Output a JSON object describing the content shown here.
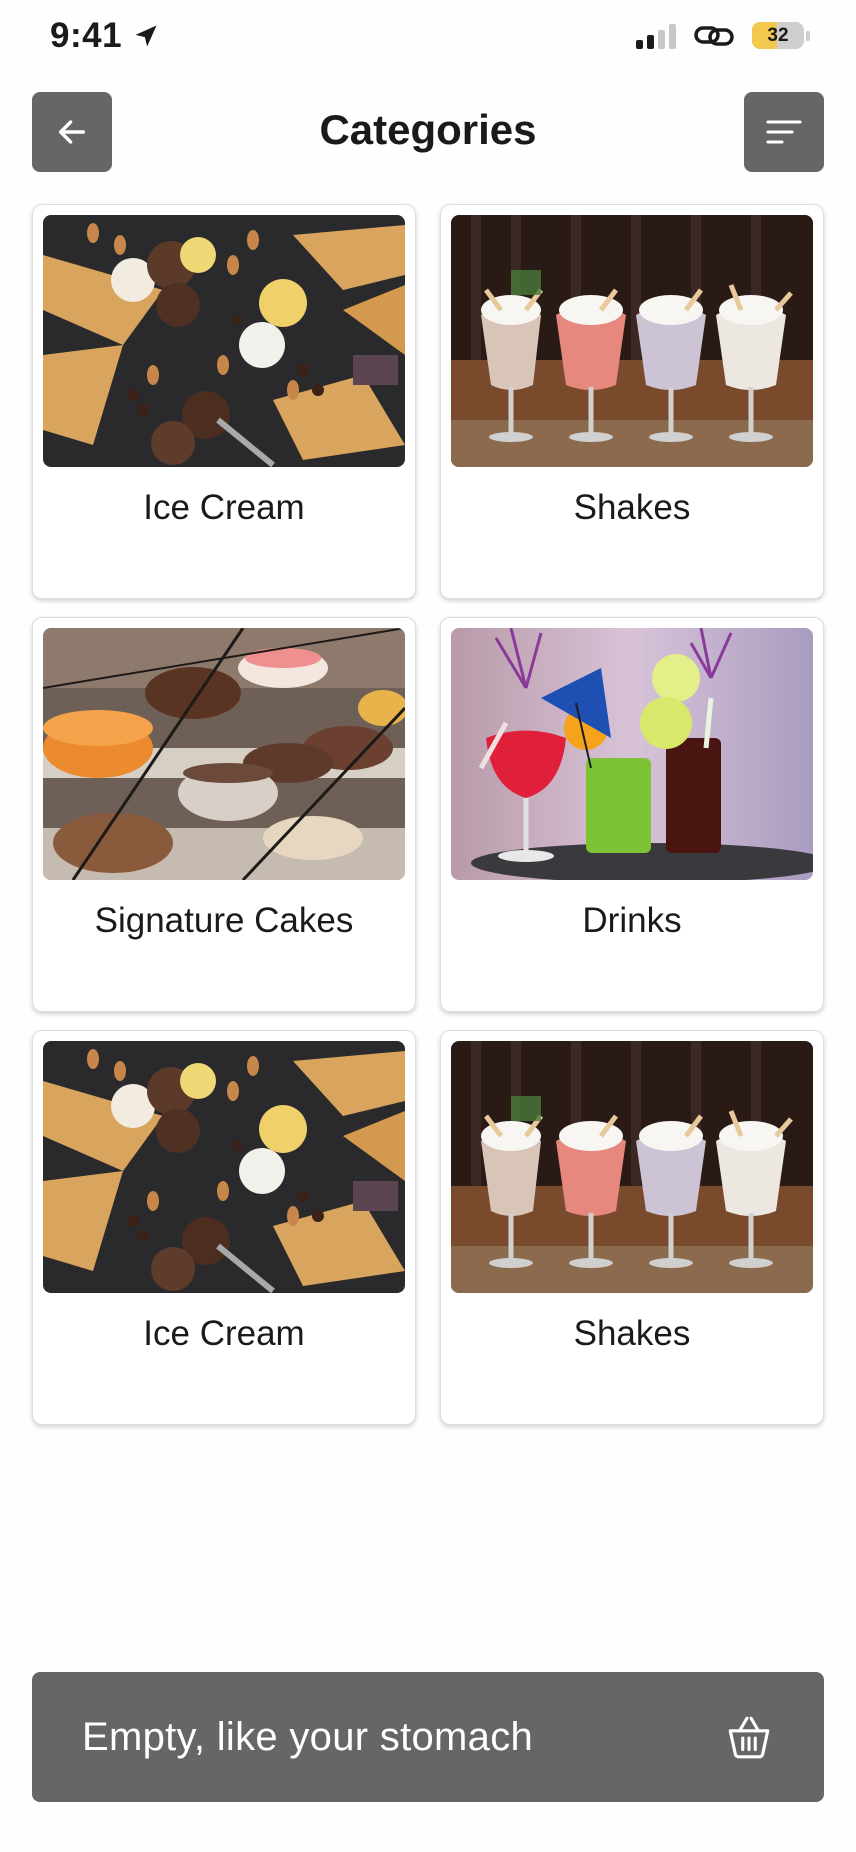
{
  "status_bar": {
    "time": "9:41",
    "battery_level": "32",
    "icons": [
      "location-arrow-icon",
      "cellular-signal-icon",
      "link-icon",
      "battery-icon"
    ]
  },
  "header": {
    "title": "Categories",
    "back_icon": "arrow-left-icon",
    "menu_icon": "menu-lines-icon"
  },
  "categories": [
    {
      "name": "Ice Cream",
      "image": "ice-cream-cones"
    },
    {
      "name": "Shakes",
      "image": "milkshake-glasses"
    },
    {
      "name": "Signature Cakes",
      "image": "cake-display"
    },
    {
      "name": "Drinks",
      "image": "cocktail-drinks"
    },
    {
      "name": "Ice Cream",
      "image": "ice-cream-cones"
    },
    {
      "name": "Shakes",
      "image": "milkshake-glasses"
    }
  ],
  "cart": {
    "text": "Empty, like your stomach",
    "icon": "basket-icon"
  },
  "colors": {
    "button_bg": "#666666",
    "battery_fill": "#f2c94c",
    "background": "#fefefe"
  }
}
